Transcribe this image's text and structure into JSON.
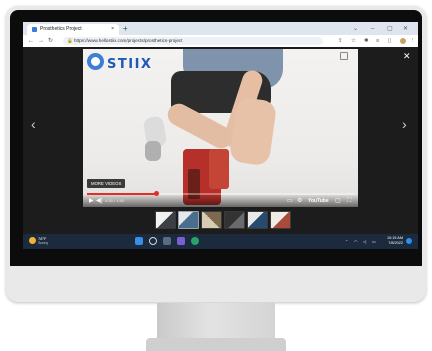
{
  "browser": {
    "tab_title": "Prosthetics Project",
    "tab_close": "×",
    "new_tab": "+",
    "url": "https://www.hellostiix.com/projects/prosthetics-project",
    "window_controls": [
      "⌄",
      "–",
      "▢",
      "✕"
    ]
  },
  "video": {
    "brand": "STIIX",
    "more_videos": "MORE VIDEOS",
    "time": "0:18 / 1:43",
    "platform": "YouTube",
    "progress_fraction": 0.26
  },
  "lightbox": {
    "close_glyph": "✕",
    "prev_glyph": "‹",
    "next_glyph": "›",
    "thumbnail_count": 6,
    "active_thumbnail": 1
  },
  "taskbar": {
    "temperature": "78°F",
    "weather": "Sunny",
    "time": "10:15 AM",
    "date": "7/8/2022"
  },
  "colors": {
    "accent_red": "#e52d27",
    "brand_blue": "#1f59b8",
    "taskbar": "#1b2a3c"
  }
}
